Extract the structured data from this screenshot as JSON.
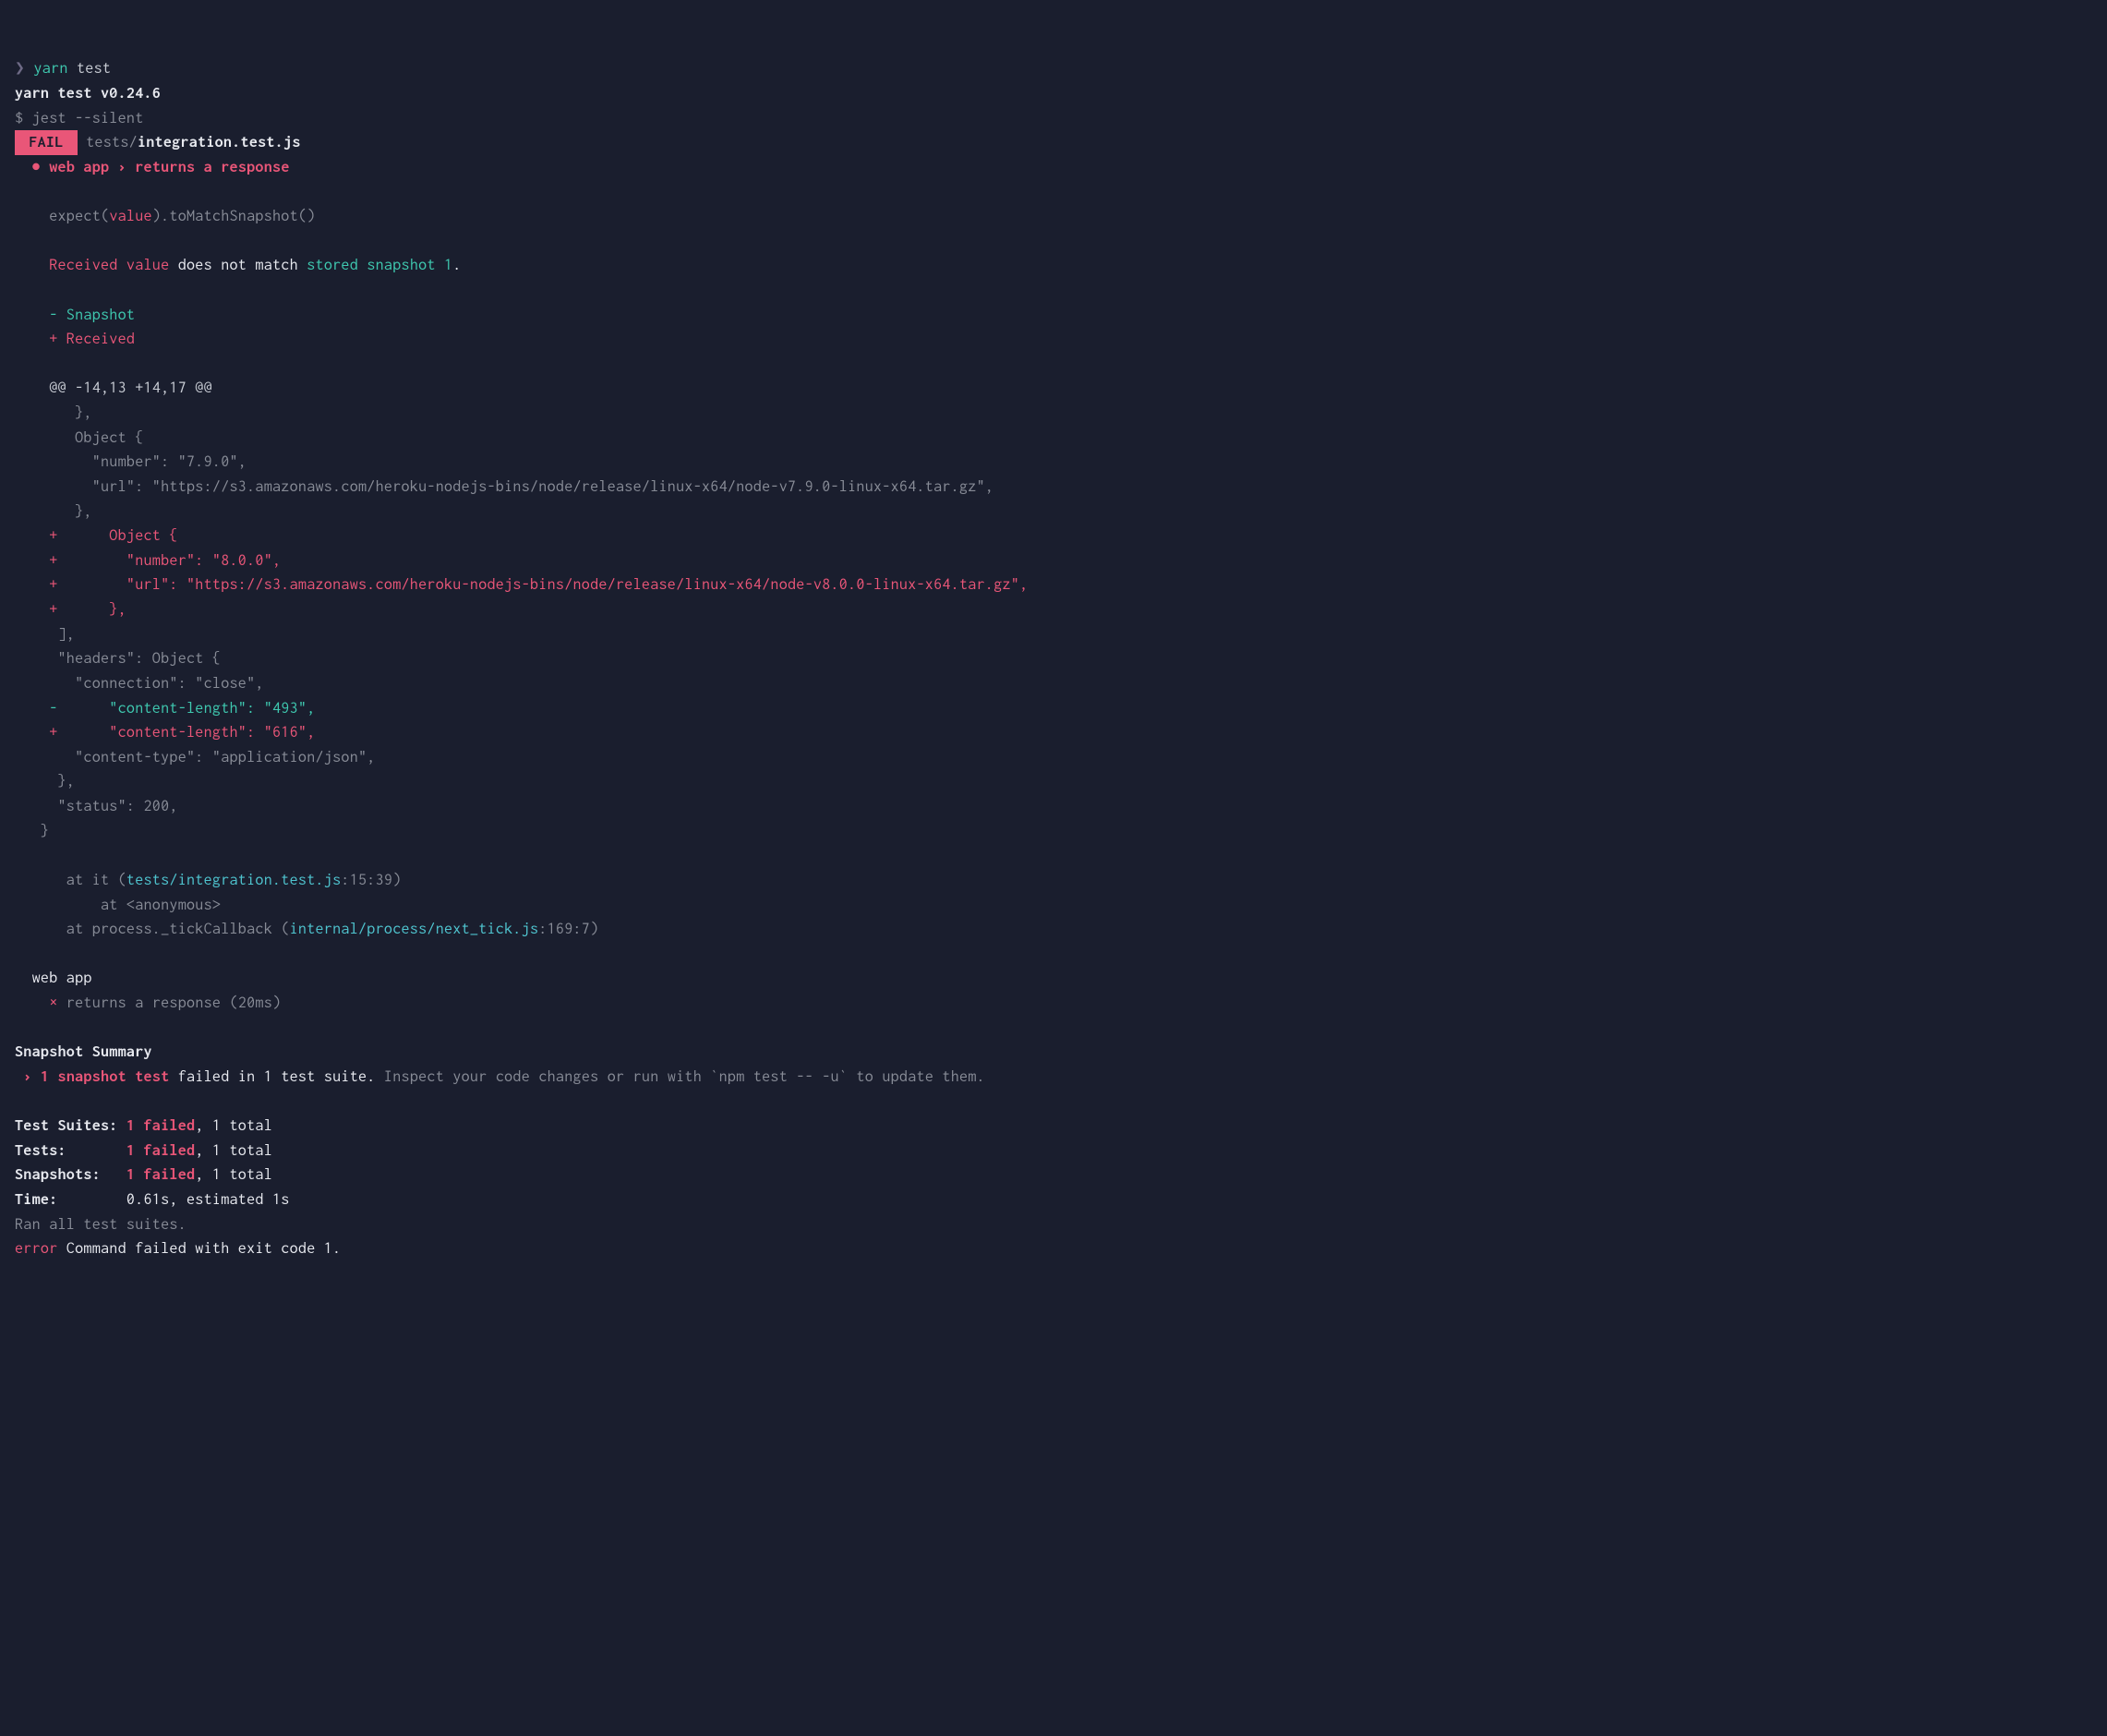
{
  "prompt": {
    "arrow": "❯",
    "cmd": "yarn",
    "arg": "test"
  },
  "yarn_version": "yarn test v0.24.6",
  "jest_cmd": "$ jest --silent",
  "fail_badge": " FAIL ",
  "test_path_dir": "tests/",
  "test_path_file": "integration.test.js",
  "test_bullet": "●",
  "test_name": "web app › returns a response",
  "expect_line": {
    "p1": "expect(",
    "p2": "value",
    "p3": ").toMatchSnapshot()"
  },
  "received_line": {
    "p1": "Received value",
    "p2": " does not match ",
    "p3": "stored snapshot 1",
    "p4": "."
  },
  "snapshot_label": "- Snapshot",
  "received_label": "+ Received",
  "hunk": "@@ -14,13 +14,17 @@",
  "diff": {
    "l1": "       },",
    "l2": "       Object {",
    "l3": "         \"number\": \"7.9.0\",",
    "l4": "         \"url\": \"https://s3.amazonaws.com/heroku-nodejs-bins/node/release/linux-x64/node-v7.9.0-linux-x64.tar.gz\",",
    "l5": "       },",
    "l6": "+      Object {",
    "l7": "+        \"number\": \"8.0.0\",",
    "l8": "+        \"url\": \"https://s3.amazonaws.com/heroku-nodejs-bins/node/release/linux-x64/node-v8.0.0-linux-x64.tar.gz\",",
    "l9": "+      },",
    "l10": "     ],",
    "l11": "     \"headers\": Object {",
    "l12": "       \"connection\": \"close\",",
    "l13": "-      \"content-length\": \"493\",",
    "l14": "+      \"content-length\": \"616\",",
    "l15": "       \"content-type\": \"application/json\",",
    "l16": "     },",
    "l17": "     \"status\": 200,",
    "l18": "   }"
  },
  "stack": {
    "s1_pre": "      at it (",
    "s1_loc": "tests/integration.test.js",
    "s1_post": ":15:39)",
    "s2": "          at <anonymous>",
    "s3_pre": "      at process._tickCallback (",
    "s3_loc": "internal/process/next_tick.js",
    "s3_post": ":169:7)"
  },
  "suite_name": "  web app",
  "result_x": "✕",
  "result_text": "returns a response (20ms)",
  "snapshot_summary_title": "Snapshot Summary",
  "snapshot_summary_bullet": " ›",
  "snapshot_summary_count": "1 snapshot test",
  "snapshot_summary_rest": " failed in 1 test suite.",
  "snapshot_summary_hint": " Inspect your code changes or run with `npm test -- -u` to update them.",
  "summary": {
    "suites_label": "Test Suites: ",
    "suites_fail": "1 failed",
    "suites_rest": ", 1 total",
    "tests_label": "Tests:       ",
    "tests_fail": "1 failed",
    "tests_rest": ", 1 total",
    "snaps_label": "Snapshots:   ",
    "snaps_fail": "1 failed",
    "snaps_rest": ", 1 total",
    "time_label": "Time:        ",
    "time_val": "0.61s, estimated 1s"
  },
  "ran_all": "Ran all test suites.",
  "error_label": "error",
  "error_msg": " Command failed with exit code 1."
}
